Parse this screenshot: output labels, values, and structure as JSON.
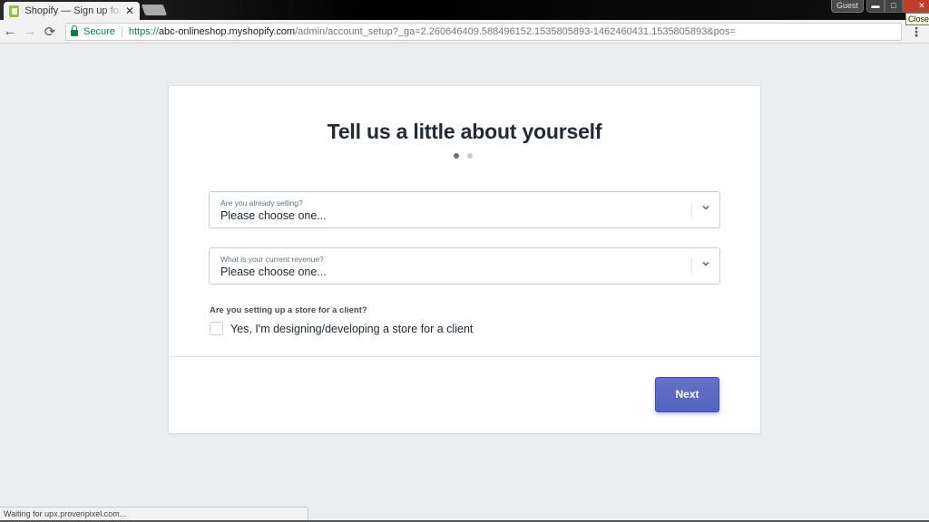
{
  "browser": {
    "tab_title": "Shopify — Sign up for the",
    "tab_close": "✕",
    "guest_label": "Guest",
    "window_buttons": {
      "minimize": "▬",
      "maximize": "□",
      "close": "✕"
    },
    "close_tooltip": "Close",
    "nav": {
      "back": "←",
      "forward": "→",
      "reload": "⟳"
    },
    "secure_label": "Secure",
    "url": {
      "scheme": "https://",
      "host": "abc-onlineshop.myshopify.com",
      "path": "/admin/account_setup?_ga=2.260646409.588496152.1535805893-1462460431.1535805893&pos="
    },
    "menu_icon": "⋮",
    "status_text": "Waiting for upx.provenpixel.com..."
  },
  "form": {
    "title": "Tell us a little about yourself",
    "steps": {
      "current": 1,
      "total": 2
    },
    "fields": [
      {
        "label": "Are you already selling?",
        "value": "Please choose one..."
      },
      {
        "label": "What is your current revenue?",
        "value": "Please choose one..."
      }
    ],
    "client_question": "Are you setting up a store for a client?",
    "client_checkbox": {
      "label": "Yes, I'm designing/developing a store for a client",
      "checked": false
    },
    "next_button": "Next"
  },
  "colors": {
    "accent": "#5c6ac4",
    "page_background": "#ebeef0",
    "heading_text": "#212b36",
    "secure_green": "#0b8043"
  }
}
